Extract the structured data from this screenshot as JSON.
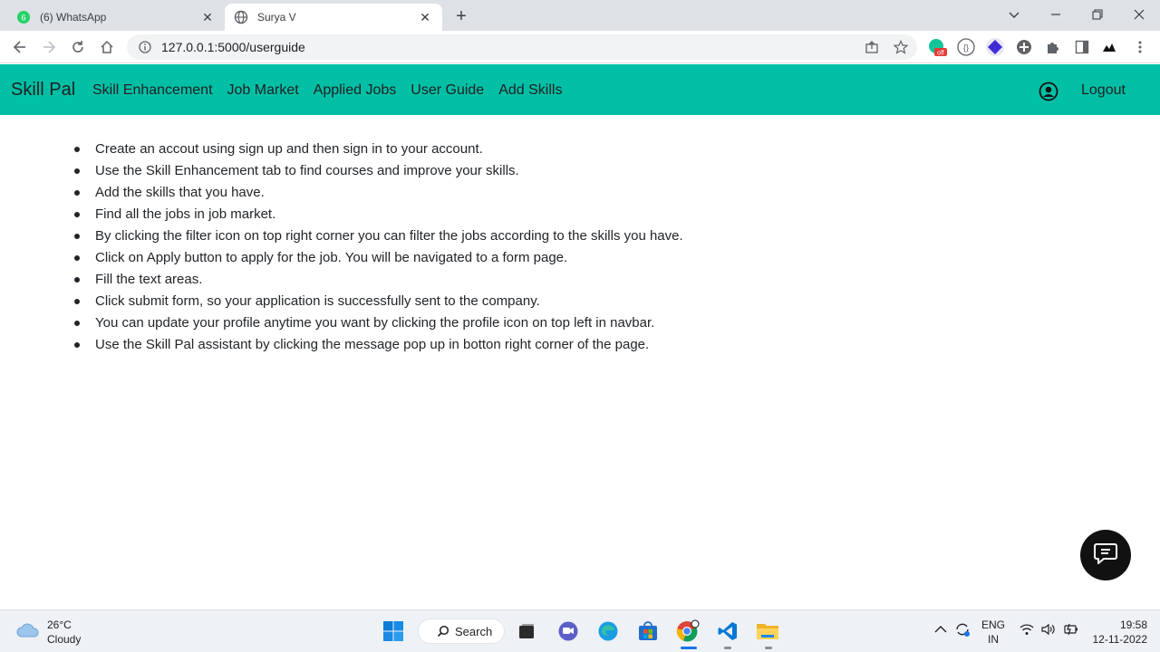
{
  "browser": {
    "tabs": [
      {
        "title": "(6) WhatsApp",
        "badge": "6",
        "active": false
      },
      {
        "title": "Surya V",
        "active": true
      }
    ],
    "new_tab_label": "+",
    "url": "127.0.0.1:5000/userguide",
    "extension_badge": "off"
  },
  "site": {
    "brand": "Skill Pal",
    "nav_links": [
      "Skill Enhancement",
      "Job Market",
      "Applied Jobs",
      "User Guide",
      "Add Skills"
    ],
    "logout_label": "Logout",
    "nav_color": "#00bfa5"
  },
  "guide": {
    "items": [
      "Create an accout using sign up and then sign in to your account.",
      "Use the Skill Enhancement tab to find courses and improve your skills.",
      "Add the skills that you have.",
      "Find all the jobs in job market.",
      "By clicking the filter icon on top right corner you can filter the jobs according to the skills you have.",
      "Click on Apply button to apply for the job. You will be navigated to a form page.",
      "Fill the text areas.",
      "Click submit form, so your application is successfully sent to the company.",
      "You can update your profile anytime you want by clicking the profile icon on top left in navbar.",
      "Use the Skill Pal assistant by clicking the message pop up in botton right corner of the page."
    ]
  },
  "taskbar": {
    "weather_temp": "26°C",
    "weather_desc": "Cloudy",
    "search_label": "Search",
    "lang_line1": "ENG",
    "lang_line2": "IN",
    "time": "19:58",
    "date": "12-11-2022"
  }
}
